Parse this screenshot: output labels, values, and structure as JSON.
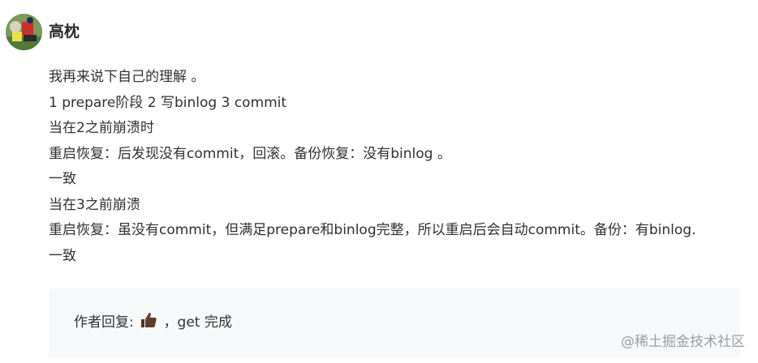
{
  "comment": {
    "author": "高枕",
    "lines": [
      "我再来说下自己的理解 。",
      "1 prepare阶段 2 写binlog 3 commit",
      "当在2之前崩溃时",
      "重启恢复：后发现没有commit，回滚。备份恢复：没有binlog 。",
      "一致",
      "当在3之前崩溃",
      "重启恢复：虽没有commit，但满足prepare和binlog完整，所以重启后会自动commit。备份：有binlog.",
      "一致"
    ]
  },
  "reply": {
    "label": "作者回复:",
    "emoji_icon": "thumbs-up-icon",
    "text": "，get 完成"
  },
  "watermark": "@稀土掘金技术社区"
}
